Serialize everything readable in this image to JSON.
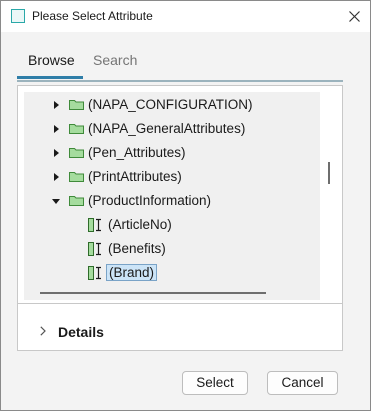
{
  "window": {
    "title": "Please Select Attribute",
    "accent_color": "#2aa8a8"
  },
  "tabs": [
    {
      "label": "Browse",
      "active": true
    },
    {
      "label": "Search",
      "active": false
    }
  ],
  "tree": {
    "items": [
      {
        "label": "(NAPA_CONFIGURATION)",
        "type": "folder",
        "expanded": false,
        "icon": "folder-icon"
      },
      {
        "label": "(NAPA_GeneralAttributes)",
        "type": "folder",
        "expanded": false,
        "icon": "folder-icon"
      },
      {
        "label": "(Pen_Attributes)",
        "type": "folder",
        "expanded": false,
        "icon": "folder-icon"
      },
      {
        "label": "(PrintAttributes)",
        "type": "folder",
        "expanded": false,
        "icon": "folder-icon"
      },
      {
        "label": "(ProductInformation)",
        "type": "folder",
        "expanded": true,
        "icon": "folder-open-icon"
      },
      {
        "label": "(ArticleNo)",
        "type": "attribute",
        "icon": "attribute-icon"
      },
      {
        "label": "(Benefits)",
        "type": "attribute",
        "icon": "attribute-icon"
      },
      {
        "label": "(Brand)",
        "type": "attribute",
        "icon": "attribute-icon",
        "selected": true
      }
    ]
  },
  "details": {
    "label": "Details"
  },
  "buttons": {
    "select": "Select",
    "cancel": "Cancel"
  }
}
